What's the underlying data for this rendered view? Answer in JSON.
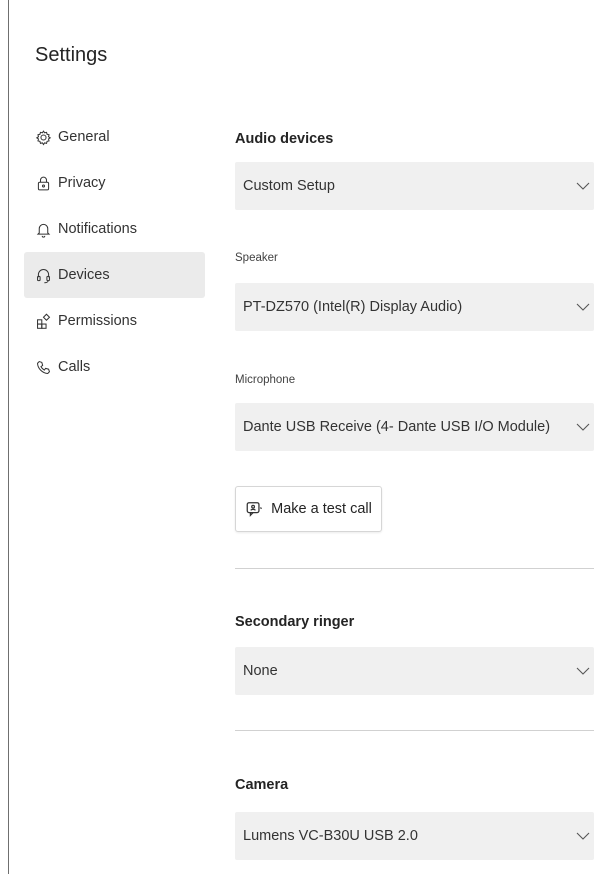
{
  "page_title": "Settings",
  "nav": {
    "items": [
      {
        "label": "General",
        "icon": "gear-icon"
      },
      {
        "label": "Privacy",
        "icon": "lock-icon"
      },
      {
        "label": "Notifications",
        "icon": "bell-icon"
      },
      {
        "label": "Devices",
        "icon": "headset-icon",
        "active": true
      },
      {
        "label": "Permissions",
        "icon": "apps-icon"
      },
      {
        "label": "Calls",
        "icon": "phone-icon"
      }
    ]
  },
  "audio": {
    "title": "Audio devices",
    "selected": "Custom Setup",
    "speaker_label": "Speaker",
    "speaker_value": "PT-DZ570 (Intel(R) Display Audio)",
    "microphone_label": "Microphone",
    "microphone_value": "Dante USB Receive (4- Dante USB I/O Module)",
    "test_call_label": "Make a test call"
  },
  "ringer": {
    "title": "Secondary ringer",
    "selected": "None"
  },
  "camera": {
    "title": "Camera",
    "selected": "Lumens VC-B30U USB 2.0"
  },
  "colors": {
    "background": "#ffffff",
    "dropdown_bg": "#f0f0f0",
    "active_nav_bg": "#ebebeb",
    "text": "#242424",
    "divider": "#d1d1d1"
  }
}
